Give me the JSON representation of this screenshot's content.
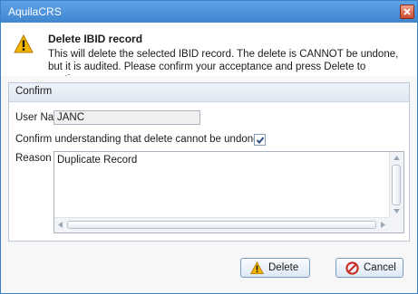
{
  "window": {
    "title": "AquilaCRS"
  },
  "header": {
    "title": "Delete IBID record",
    "description": "This will delete the selected IBID record. The delete is CANNOT be undone, but it is audited.  Please confirm your acceptance and press Delete to continue."
  },
  "confirm_group": {
    "label": "Confirm",
    "user_name_label": "User Name",
    "user_name_value": "JANC",
    "checkbox_label": "Confirm understanding that delete cannot be undone",
    "checkbox_checked": true,
    "reason_label": "Reason",
    "reason_value": "Duplicate Record"
  },
  "buttons": {
    "delete": "Delete",
    "cancel": "Cancel"
  },
  "icons": {
    "warning": "warning-icon",
    "close": "close-icon",
    "cancel": "no-entry-icon",
    "check": "checkmark-icon"
  },
  "colors": {
    "titlebar": "#4a90d9",
    "warning": "#f0a800"
  }
}
